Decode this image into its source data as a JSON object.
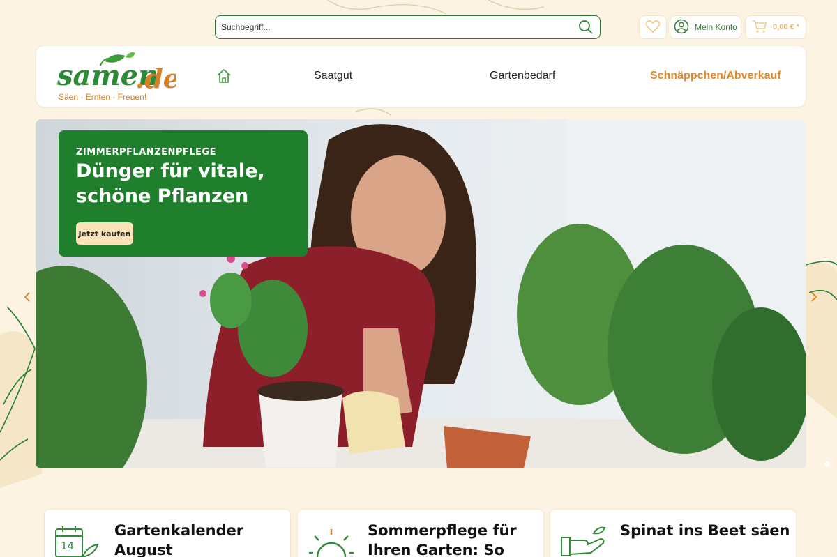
{
  "header": {
    "search": {
      "placeholder": "Suchbegriff..."
    },
    "account_label": "Mein Konto",
    "cart_total": "0,00 € *"
  },
  "logo": {
    "wordmark": "samen.de",
    "tagline": "Säen · Ernten · Freuen!"
  },
  "nav": {
    "items": [
      {
        "label": "Saatgut"
      },
      {
        "label": "Gartenbedarf"
      },
      {
        "label": "Schnäppchen/Abverkauf"
      }
    ]
  },
  "hero": {
    "eyebrow": "ZIMMERPFLANZENPFLEGE",
    "title_line1": "Dünger für vitale,",
    "title_line2": "schöne Pflanzen",
    "cta": "Jetzt kaufen"
  },
  "cards": [
    {
      "title": "Gartenkalender August",
      "icon": "calendar-icon",
      "calendar_day": "14"
    },
    {
      "title": "Sommerpflege für Ihren Garten: So",
      "icon": "sun-icon"
    },
    {
      "title": "Spinat ins Beet säen",
      "icon": "hand-seed-icon"
    }
  ],
  "colors": {
    "brand_green": "#1f7f2c",
    "accent_orange": "#e08a2a",
    "background": "#fdf3e3",
    "cta_bg": "#fbe2b8"
  }
}
